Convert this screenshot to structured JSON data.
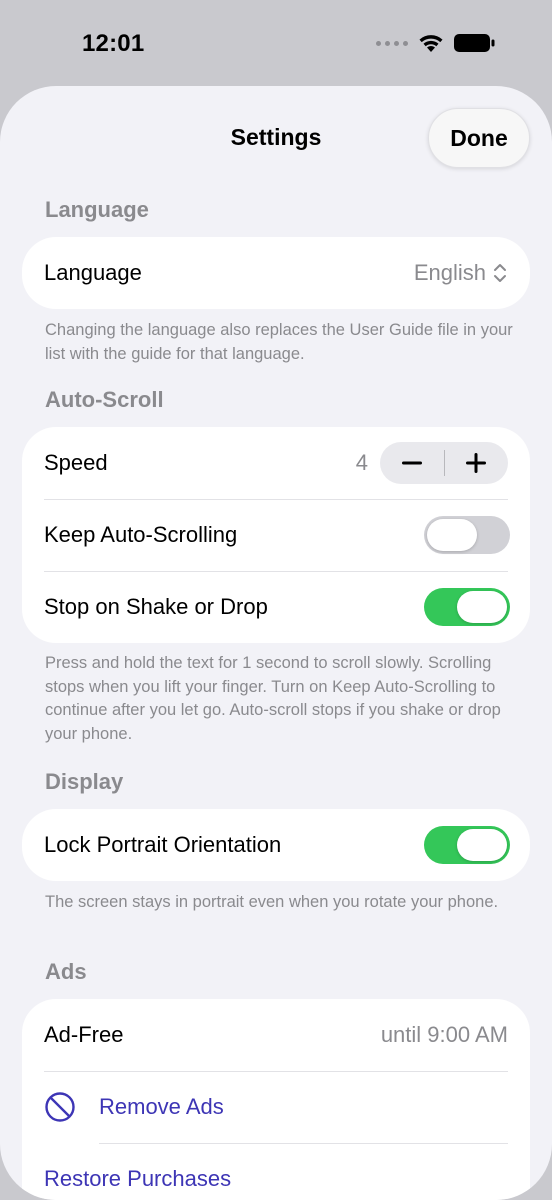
{
  "status": {
    "time": "12:01"
  },
  "nav": {
    "title": "Settings",
    "done_label": "Done"
  },
  "sections": {
    "language": {
      "header": "Language",
      "row_label": "Language",
      "row_value": "English",
      "footer": "Changing the language also replaces the User Guide file in your list with the guide for that language."
    },
    "autoscroll": {
      "header": "Auto-Scroll",
      "speed_label": "Speed",
      "speed_value": "4",
      "keep_label": "Keep Auto-Scrolling",
      "keep_on": false,
      "stop_label": "Stop on Shake or Drop",
      "stop_on": true,
      "footer": "Press and hold the text for 1 second to scroll slowly. Scrolling stops when you lift your finger. Turn on Keep Auto-Scrolling to continue after you let go. Auto-scroll stops if you shake or drop your phone."
    },
    "display": {
      "header": "Display",
      "lock_label": "Lock Portrait Orientation",
      "lock_on": true,
      "footer": "The screen stays in portrait even when you rotate your phone."
    },
    "ads": {
      "header": "Ads",
      "adfree_label": "Ad-Free",
      "adfree_value": "until 9:00 AM",
      "remove_label": "Remove Ads",
      "restore_label": "Restore Purchases"
    }
  },
  "colors": {
    "accent": "#3d35b5",
    "toggle_on": "#34c759",
    "toggle_off": "#d1d1d6"
  },
  "icons": [
    "wifi-icon",
    "battery-icon",
    "chevron-up-down-icon",
    "minus-icon",
    "plus-icon",
    "no-entry-icon"
  ]
}
